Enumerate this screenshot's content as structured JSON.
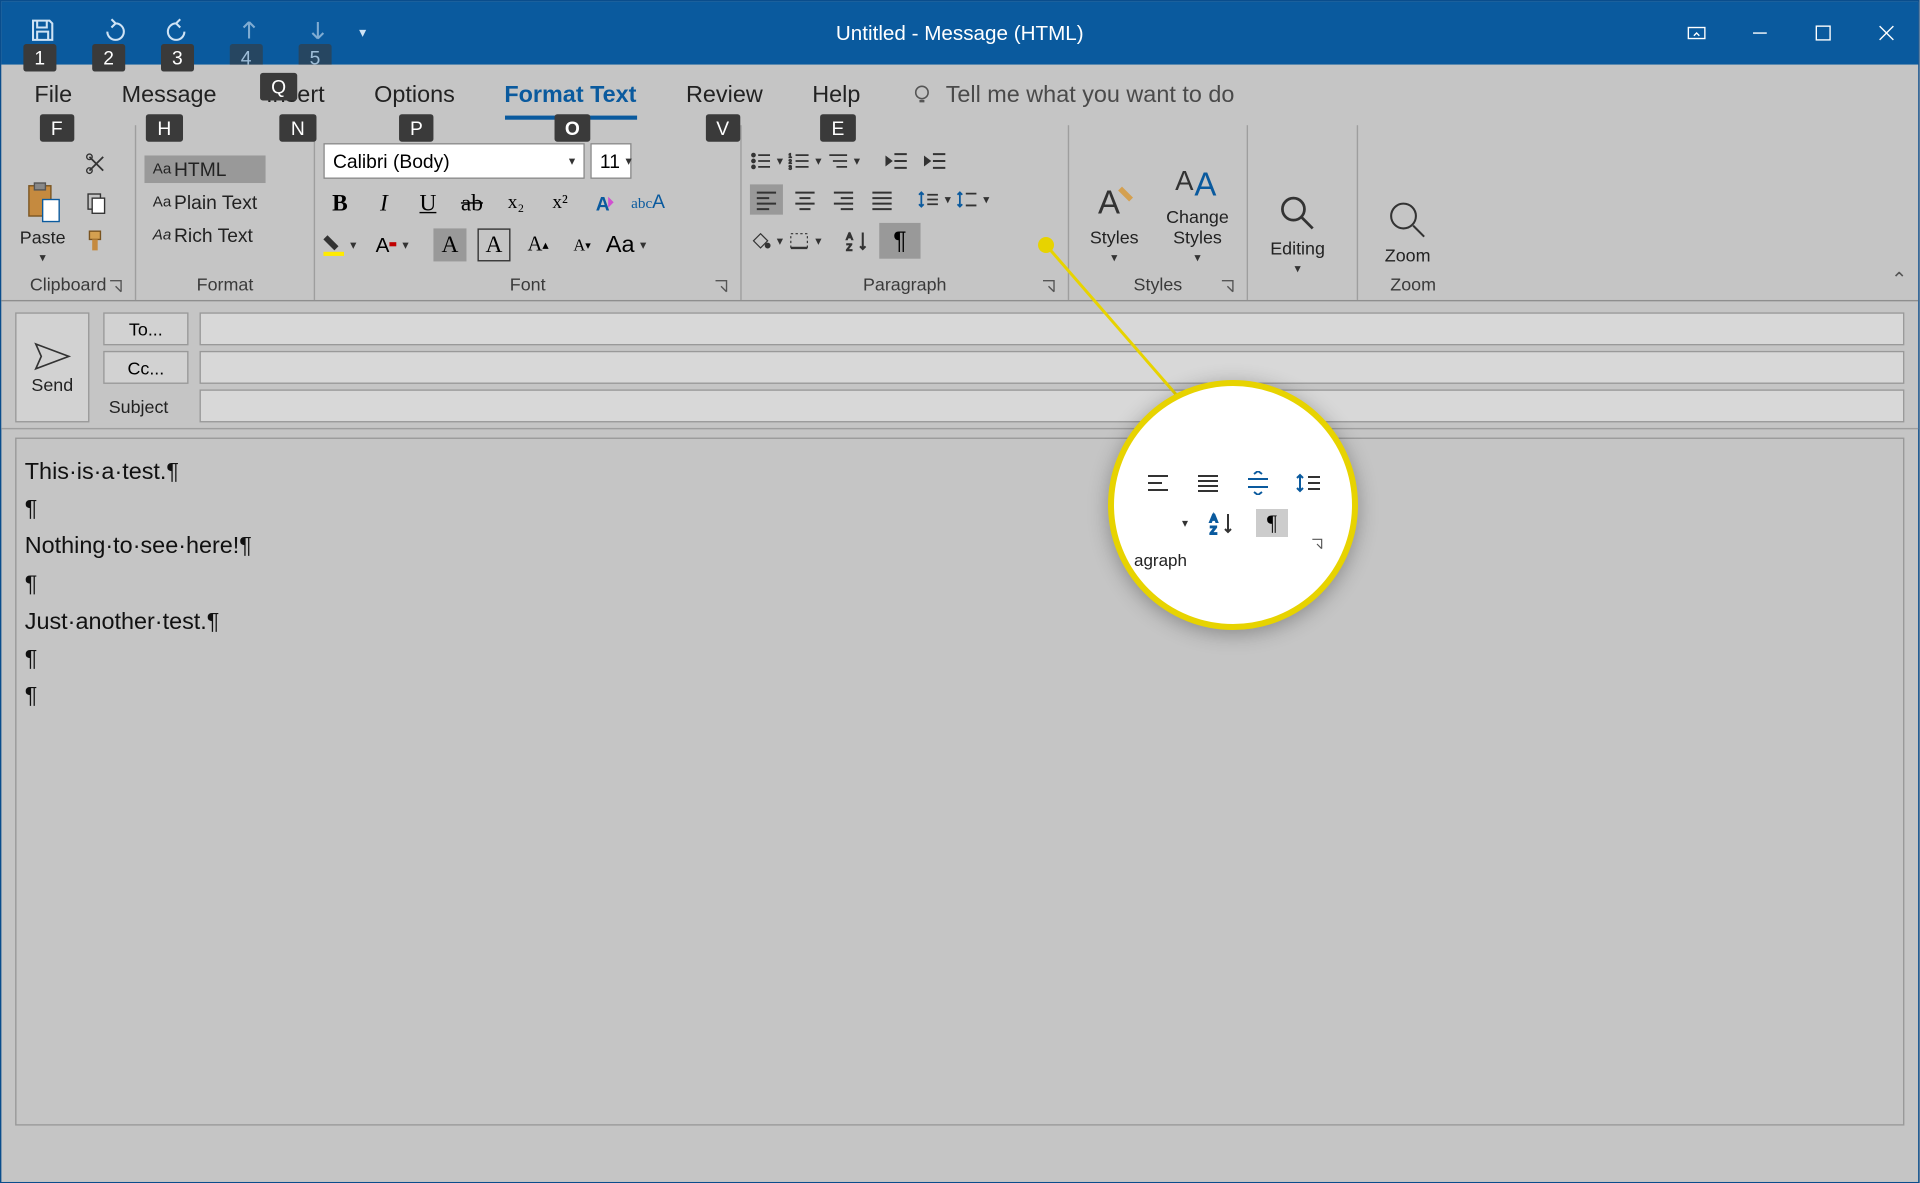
{
  "title": "Untitled  -  Message (HTML)",
  "qat_badges": [
    "1",
    "2",
    "3",
    "4",
    "5"
  ],
  "tabs": [
    {
      "label": "File",
      "key": "F"
    },
    {
      "label": "Message",
      "key": "H"
    },
    {
      "label": "Insert",
      "key": "N"
    },
    {
      "label": "Options",
      "key": "P"
    },
    {
      "label": "Format Text",
      "key": "O",
      "active": true
    },
    {
      "label": "Review",
      "key": "V"
    },
    {
      "label": "Help",
      "key": "E"
    }
  ],
  "tellme": {
    "text": "Tell me what you want to do",
    "key": "Q"
  },
  "ribbon": {
    "clipboard": {
      "paste": "Paste",
      "label": "Clipboard"
    },
    "format": {
      "label": "Format",
      "html": "HTML",
      "plain": "Plain Text",
      "rich": "Rich Text",
      "aa": "Aa"
    },
    "font": {
      "label": "Font",
      "name": "Calibri (Body)",
      "size": "11",
      "buttons": {
        "b": "B",
        "i": "I",
        "u": "U",
        "s": "ab",
        "sub": "x₂",
        "sup": "x²"
      },
      "case": "Aa"
    },
    "paragraph": {
      "label": "Paragraph",
      "pilcrow": "¶"
    },
    "styles": {
      "label": "Styles",
      "styles": "Styles",
      "change": "Change Styles"
    },
    "editing": {
      "label": "Editing",
      "editing": "Editing"
    },
    "zoom": {
      "label": "Zoom",
      "zoom": "Zoom"
    }
  },
  "compose": {
    "send": "Send",
    "to": "To...",
    "cc": "Cc...",
    "subject": "Subject"
  },
  "body_lines": [
    "This·is·a·test.¶",
    "¶",
    "Nothing·to·see·here!¶",
    "¶",
    "Just·another·test.¶",
    "¶",
    "¶"
  ],
  "callout": {
    "label": "agraph",
    "pilcrow": "¶"
  }
}
